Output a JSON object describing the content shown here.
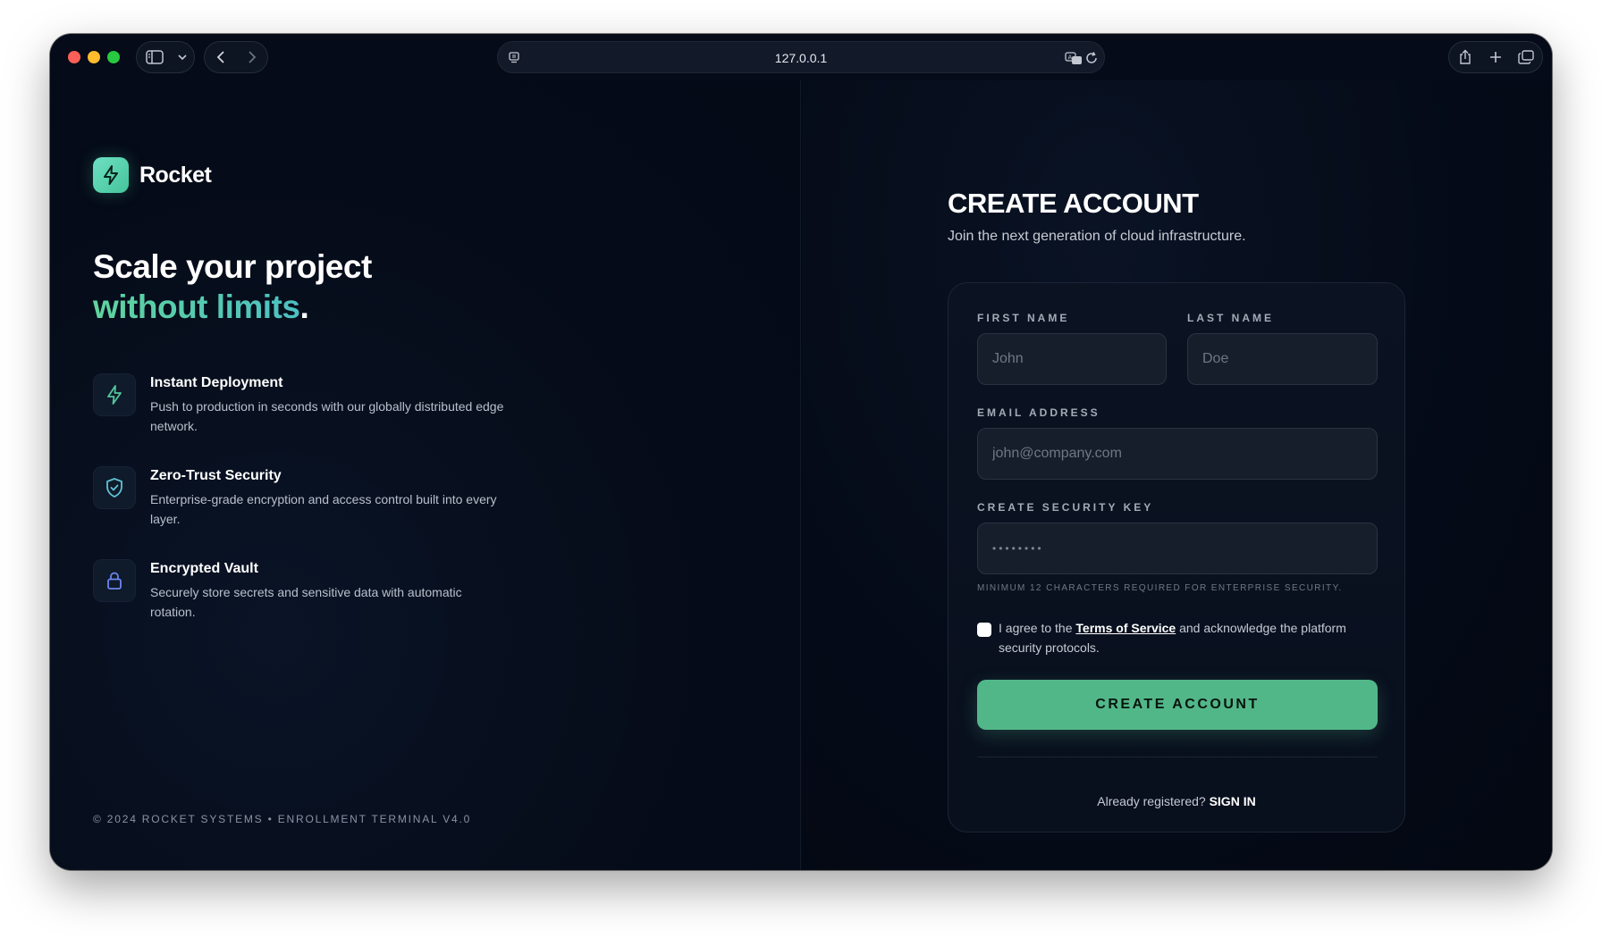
{
  "browser": {
    "url": "127.0.0.1",
    "sidebar_icon": "sidebar-icon",
    "back_icon": "chevron-left-icon",
    "forward_icon": "chevron-right-icon",
    "share_icon": "share-icon",
    "new_tab_icon": "plus-icon",
    "tabs_icon": "tabs-overview-icon"
  },
  "brand": {
    "name": "Rocket",
    "accent": "#52b788"
  },
  "hero": {
    "line1": "Scale your project",
    "line2_highlight": "without limits",
    "line2_end": "."
  },
  "features": [
    {
      "icon": "lightning-icon",
      "title": "Instant Deployment",
      "description": "Push to production in seconds with our globally distributed edge network."
    },
    {
      "icon": "shield-check-icon",
      "title": "Zero-Trust Security",
      "description": "Enterprise-grade encryption and access control built into every layer."
    },
    {
      "icon": "lock-icon",
      "title": "Encrypted Vault",
      "description": "Securely store secrets and sensitive data with automatic rotation."
    }
  ],
  "footer": "© 2024 ROCKET SYSTEMS • ENROLLMENT TERMINAL V4.0",
  "form": {
    "title": "CREATE ACCOUNT",
    "subtitle": "Join the next generation of cloud infrastructure.",
    "first_name": {
      "label": "FIRST NAME",
      "placeholder": "John",
      "value": ""
    },
    "last_name": {
      "label": "LAST NAME",
      "placeholder": "Doe",
      "value": ""
    },
    "email": {
      "label": "EMAIL ADDRESS",
      "placeholder": "john@company.com",
      "value": ""
    },
    "password": {
      "label": "CREATE SECURITY KEY",
      "placeholder": "••••••••",
      "value": ""
    },
    "password_hint": "MINIMUM 12 CHARACTERS REQUIRED FOR ENTERPRISE SECURITY.",
    "agree_prefix": "I agree to the ",
    "agree_link": "Terms of Service",
    "agree_suffix": " and acknowledge the platform security protocols.",
    "submit_label": "CREATE ACCOUNT",
    "signin_prompt": "Already registered? ",
    "signin_link": "SIGN IN"
  }
}
